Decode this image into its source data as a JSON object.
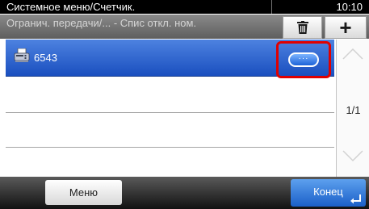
{
  "window": {
    "title": "Системное меню/Счетчик.",
    "time": "10:10"
  },
  "header": {
    "breadcrumb": "Огранич. передачи/... - Спис откл. ном.",
    "delete_icon": "trash-icon",
    "add_label": "+"
  },
  "list": {
    "items": [
      {
        "label": "6543",
        "icon": "fax-icon",
        "selected": true
      },
      {
        "label": ""
      },
      {
        "label": ""
      },
      {
        "label": ""
      }
    ],
    "detail_label": "···"
  },
  "scroll": {
    "page_indicator": "1/1",
    "up_icon": "chevron-up-icon",
    "down_icon": "chevron-down-icon"
  },
  "footer": {
    "menu_label": "Меню",
    "end_label": "Конец",
    "enter_icon": "enter-icon"
  },
  "colors": {
    "selected_row": "#2a5fd0",
    "highlight_border": "#e00000",
    "primary_button": "#2a72dc"
  }
}
